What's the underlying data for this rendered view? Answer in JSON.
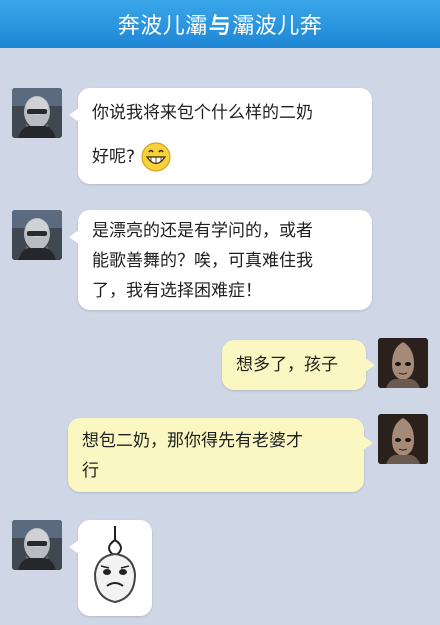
{
  "header": {
    "title_left": "奔波儿灞",
    "title_sep": "与",
    "title_right": "灞波儿奔"
  },
  "messages": [
    {
      "side": "left",
      "line1": "你说我将来包个什么样的二奶",
      "line2": "好呢?",
      "emoji": "grin-emoji"
    },
    {
      "side": "left",
      "line1": "是漂亮的还是有学问的，或者",
      "line2": "能歌善舞的？唉，可真难住我",
      "line3": "了，我有选择困难症！"
    },
    {
      "side": "right",
      "line1": "想多了，孩子"
    },
    {
      "side": "right",
      "line1": "想包二奶，那你得先有老婆才",
      "line2": "行"
    },
    {
      "side": "left",
      "sticker": "hanging-face-sticker"
    }
  ],
  "colors": {
    "background": "#cfd7e6",
    "header": "#2b96df",
    "left_bubble": "#ffffff",
    "right_bubble": "#fbf7c3"
  }
}
